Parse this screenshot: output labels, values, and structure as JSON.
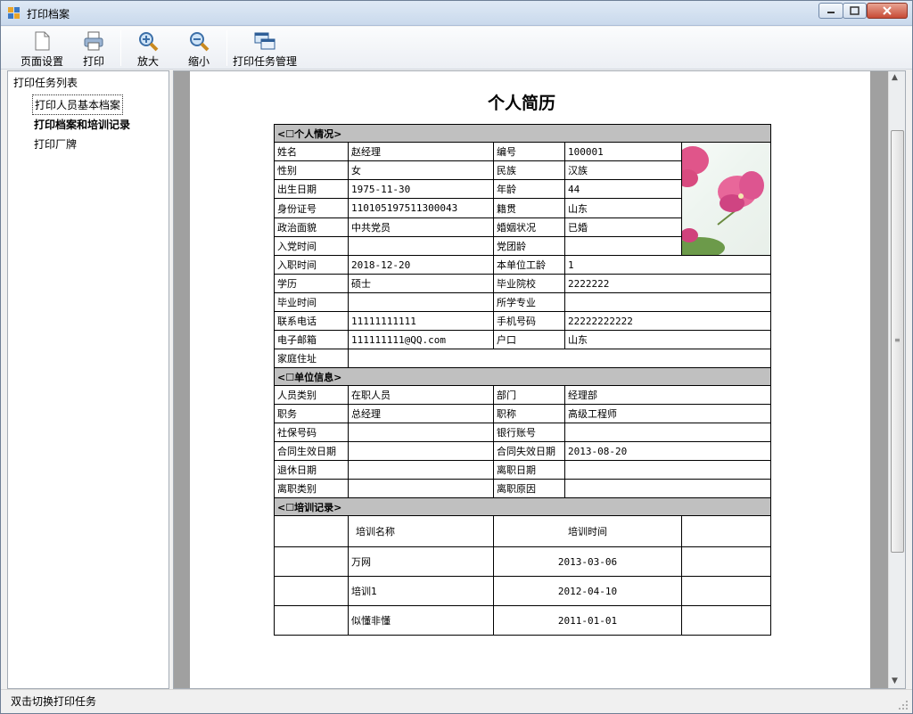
{
  "window": {
    "title": "打印档案"
  },
  "toolbar": {
    "page_setup": "页面设置",
    "print": "打印",
    "zoom_in": "放大",
    "zoom_out": "缩小",
    "print_tasks": "打印任务管理"
  },
  "tree": {
    "root": "打印任务列表",
    "items": [
      "打印人员基本档案",
      "打印档案和培训记录",
      "打印厂牌"
    ]
  },
  "document": {
    "title": "个人简历",
    "sec_personal": "<☐个人情况>",
    "sec_unit": "<☐单位信息>",
    "sec_training": "<☐培训记录>",
    "p": {
      "name_l": "姓名",
      "name_v": "赵经理",
      "no_l": "编号",
      "no_v": "100001",
      "sex_l": "性别",
      "sex_v": "女",
      "nation_l": "民族",
      "nation_v": "汉族",
      "birth_l": "出生日期",
      "birth_v": "1975-11-30",
      "age_l": "年龄",
      "age_v": "44",
      "id_l": "身份证号",
      "id_v": "110105197511300043",
      "origin_l": "籍贯",
      "origin_v": "山东",
      "pol_l": "政治面貌",
      "pol_v": "中共党员",
      "mar_l": "婚姻状况",
      "mar_v": "已婚",
      "join_party_l": "入党时间",
      "join_party_v": "",
      "party_age_l": "党团龄",
      "party_age_v": "",
      "hire_l": "入职时间",
      "hire_v": "2018-12-20",
      "tenure_l": "本单位工龄",
      "tenure_v": "1",
      "edu_l": "学历",
      "edu_v": "硕士",
      "school_l": "毕业院校",
      "school_v": "2222222",
      "grad_l": "毕业时间",
      "grad_v": "",
      "major_l": "所学专业",
      "major_v": "",
      "tel_l": "联系电话",
      "tel_v": "11111111111",
      "mob_l": "手机号码",
      "mob_v": "22222222222",
      "email_l": "电子邮箱",
      "email_v": "111111111@QQ.com",
      "hukou_l": "户口",
      "hukou_v": "山东",
      "addr_l": "家庭住址",
      "addr_v": ""
    },
    "u": {
      "cat_l": "人员类别",
      "cat_v": "在职人员",
      "dept_l": "部门",
      "dept_v": "经理部",
      "duty_l": "职务",
      "duty_v": "总经理",
      "rank_l": "职称",
      "rank_v": "高级工程师",
      "ssn_l": "社保号码",
      "ssn_v": "",
      "bank_l": "银行账号",
      "bank_v": "",
      "cstart_l": "合同生效日期",
      "cstart_v": "",
      "cend_l": "合同失效日期",
      "cend_v": "2013-08-20",
      "retire_l": "退休日期",
      "retire_v": "",
      "leave_l": "离职日期",
      "leave_v": "",
      "ltype_l": "离职类别",
      "ltype_v": "",
      "lreason_l": "离职原因",
      "lreason_v": ""
    },
    "training": {
      "h_name": "培训名称",
      "h_time": "培训时间",
      "rows": [
        {
          "name": "万网",
          "time": "2013-03-06"
        },
        {
          "name": "培训1",
          "time": "2012-04-10"
        },
        {
          "name": "似懂非懂",
          "time": "2011-01-01"
        }
      ]
    }
  },
  "status": {
    "text": "双击切换打印任务"
  }
}
